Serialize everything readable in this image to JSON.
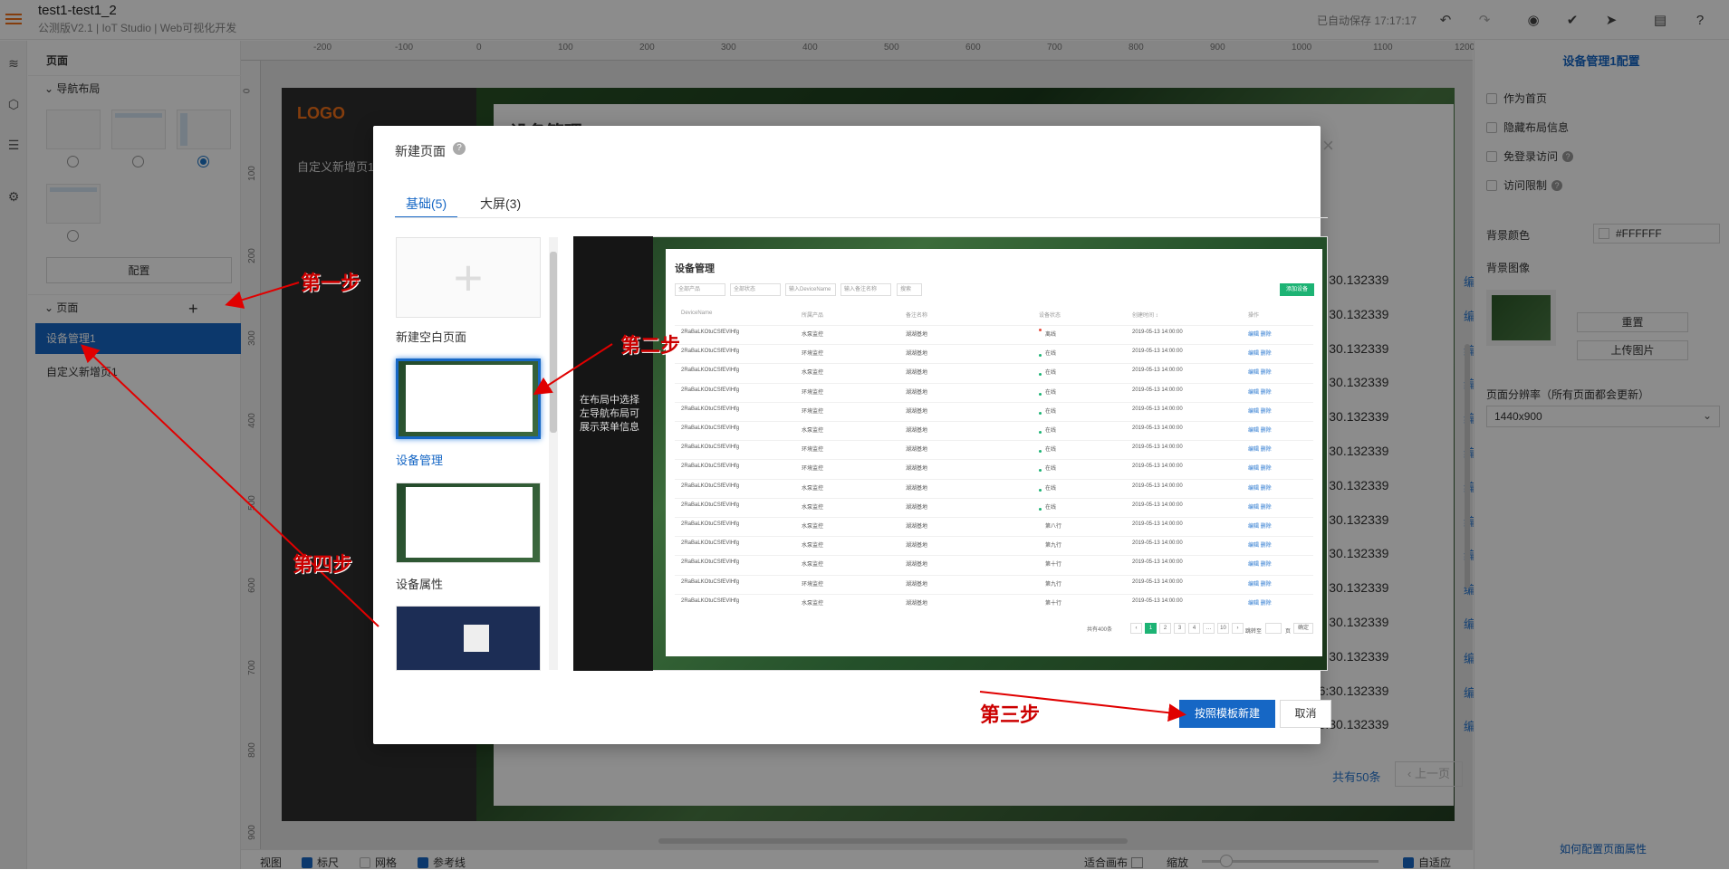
{
  "header": {
    "title": "test1-test1_2",
    "subtitle": "公测版V2.1 | IoT Studio | Web可视化开发",
    "autosave": "已自动保存 17:17:17"
  },
  "left_panel": {
    "title": "页面",
    "nav_layout_label": "导航布局",
    "config_label": "配置",
    "pages_label": "页面",
    "add_icon": "+",
    "pages": [
      "设备管理1",
      "自定义新增页1"
    ]
  },
  "ruler": {
    "h_ticks": [
      "-200",
      "-100",
      "0",
      "100",
      "200",
      "300",
      "400",
      "500",
      "600",
      "700",
      "800",
      "900",
      "1000",
      "1100",
      "1200"
    ],
    "v_ticks": [
      "0",
      "100",
      "200",
      "300",
      "400",
      "500",
      "600",
      "700",
      "800",
      "900"
    ]
  },
  "canvas_page": {
    "logo": "LOGO",
    "nav_item": "自定义新增页1",
    "title": "设备管理",
    "row_values": [
      "096:30.132339",
      "096:30.132339",
      "096:30.132339",
      "096:30.132339",
      "096:30.132339",
      "096:30.132339",
      "096:30.132339",
      "096:30.132339",
      "096:30.132339",
      "096:30.132339",
      "096:30.132339",
      "096:30.132339",
      "096:30.132339",
      "096:30.132339"
    ],
    "edit_label": "编",
    "total": "共有50条",
    "prev": "上一页"
  },
  "right_panel": {
    "title": "设备管理1配置",
    "as_home": "作为首页",
    "hide_layout": "隐藏布局信息",
    "no_login": "免登录访问",
    "access_limit": "访问限制",
    "bg_color_label": "背景颜色",
    "bg_color_value": "#FFFFFF",
    "bg_image_label": "背景图像",
    "reset": "重置",
    "upload": "上传图片",
    "resolution_label": "页面分辨率（所有页面都会更新）",
    "resolution_value": "1440x900",
    "help_link": "如何配置页面属性"
  },
  "bottom_bar": {
    "view": "视图",
    "ruler": "标尺",
    "grid": "网格",
    "guides": "参考线",
    "fit_canvas": "适合画布",
    "zoom": "缩放",
    "auto_fit": "自适应"
  },
  "modal": {
    "title": "新建页面",
    "help": "?",
    "close": "×",
    "tabs": [
      "基础(5)",
      "大屏(3)"
    ],
    "templates": [
      "新建空白页面",
      "设备管理",
      "设备属性"
    ],
    "blank_plus": "+",
    "preview": {
      "nav_text": "在布局中选择左导航布局可展示菜单信息",
      "title": "设备管理",
      "filters": [
        "全部产品",
        "全部状态",
        "输入DeviceName",
        "输入备注名称",
        "搜索"
      ],
      "add_button": "添加设备",
      "columns": [
        "DeviceName",
        "所属产品",
        "备注名称",
        "设备状态",
        "创建时间 ↕",
        "操作"
      ],
      "rows": [
        [
          "2RaBaLKOtuCSfEVlHfg",
          "水泵监控",
          "湖湖基地",
          "离线",
          "2019-05-13 14:00:00"
        ],
        [
          "2RaBaLKOtuCSfEVlHfg",
          "环境监控",
          "湖湖基地",
          "在线",
          "2019-05-13 14:00:00"
        ],
        [
          "2RaBaLKOtuCSfEVlHfg",
          "水泵监控",
          "湖湖基地",
          "在线",
          "2019-05-13 14:00:00"
        ],
        [
          "2RaBaLKOtuCSfEVlHfg",
          "环境监控",
          "湖湖基地",
          "在线",
          "2019-05-13 14:00:00"
        ],
        [
          "2RaBaLKOtuCSfEVlHfg",
          "环境监控",
          "湖湖基地",
          "在线",
          "2019-05-13 14:00:00"
        ],
        [
          "2RaBaLKOtuCSfEVlHfg",
          "水泵监控",
          "湖湖基地",
          "在线",
          "2019-05-13 14:00:00"
        ],
        [
          "2RaBaLKOtuCSfEVlHfg",
          "环境监控",
          "湖湖基地",
          "在线",
          "2019-05-13 14:00:00"
        ],
        [
          "2RaBaLKOtuCSfEVlHfg",
          "环境监控",
          "湖湖基地",
          "在线",
          "2019-05-13 14:00:00"
        ],
        [
          "2RaBaLKOtuCSfEVlHfg",
          "水泵监控",
          "湖湖基地",
          "在线",
          "2019-05-13 14:00:00"
        ],
        [
          "2RaBaLKOtuCSfEVlHfg",
          "水泵监控",
          "湖湖基地",
          "在线",
          "2019-05-13 14:00:00"
        ],
        [
          "2RaBaLKOtuCSfEVlHfg",
          "水泵监控",
          "湖湖基地",
          "第八行",
          "2019-05-13 14:00:00"
        ],
        [
          "2RaBaLKOtuCSfEVlHfg",
          "水泵监控",
          "湖湖基地",
          "第九行",
          "2019-05-13 14:00:00"
        ],
        [
          "2RaBaLKOtuCSfEVlHfg",
          "水泵监控",
          "湖湖基地",
          "第十行",
          "2019-05-13 14:00:00"
        ],
        [
          "2RaBaLKOtuCSfEVlHfg",
          "环境监控",
          "湖湖基地",
          "第九行",
          "2019-05-13 14:00:00"
        ],
        [
          "2RaBaLKOtuCSfEVlHfg",
          "水泵监控",
          "湖湖基地",
          "第十行",
          "2019-05-13 14:00:00"
        ]
      ],
      "ops": "编辑  删除",
      "pager_total": "共有400条",
      "pager_pages": [
        "‹",
        "1",
        "2",
        "3",
        "4",
        "…",
        "10",
        "›"
      ],
      "pager_jump": "跳转至",
      "pager_unit": "页",
      "pager_ok": "确定"
    },
    "create_button": "按照模板新建",
    "cancel_button": "取消"
  },
  "annotations": [
    "第一步",
    "第二步",
    "第三步",
    "第四步"
  ],
  "colors": {
    "accent": "#1667c5",
    "annotation": "#cc0000",
    "logo": "#f07018"
  }
}
